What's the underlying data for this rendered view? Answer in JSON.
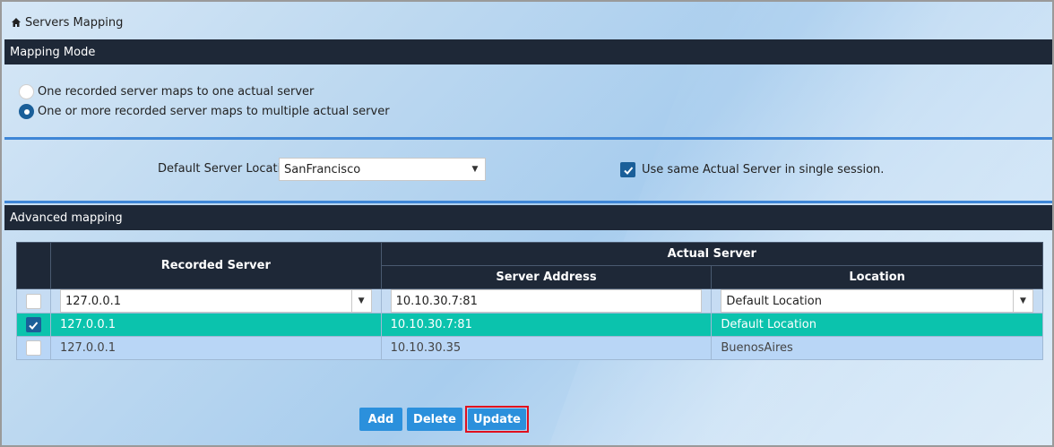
{
  "page": {
    "title": "Servers Mapping"
  },
  "mapping_mode": {
    "header": "Mapping Mode",
    "options": [
      {
        "label": "One recorded server maps to one actual server",
        "selected": false
      },
      {
        "label": "One or more recorded server maps to multiple actual server",
        "selected": true
      }
    ]
  },
  "defaults": {
    "location_label": "Default Server Location",
    "location_value": "SanFrancisco",
    "same_server_label": "Use same Actual Server in single session.",
    "same_server_checked": true
  },
  "advanced": {
    "header": "Advanced mapping",
    "columns": {
      "recorded": "Recorded Server",
      "actual": "Actual Server",
      "address": "Server Address",
      "location": "Location"
    },
    "edit_row": {
      "recorded": "127.0.0.1",
      "address": "10.10.30.7:81",
      "location": "Default Location"
    },
    "rows": [
      {
        "recorded": "127.0.0.1",
        "address": "10.10.30.7:81",
        "location": "Default Location",
        "checked": true
      },
      {
        "recorded": "127.0.0.1",
        "address": "10.10.30.35",
        "location": "BuenosAires",
        "checked": false
      }
    ]
  },
  "buttons": {
    "add": "Add",
    "delete": "Delete",
    "update": "Update"
  },
  "colors": {
    "header_bg": "#1e2837",
    "accent_blue": "#2b90dc",
    "selected_row": "#0bc3ad",
    "highlight_outline": "#e0101e"
  }
}
